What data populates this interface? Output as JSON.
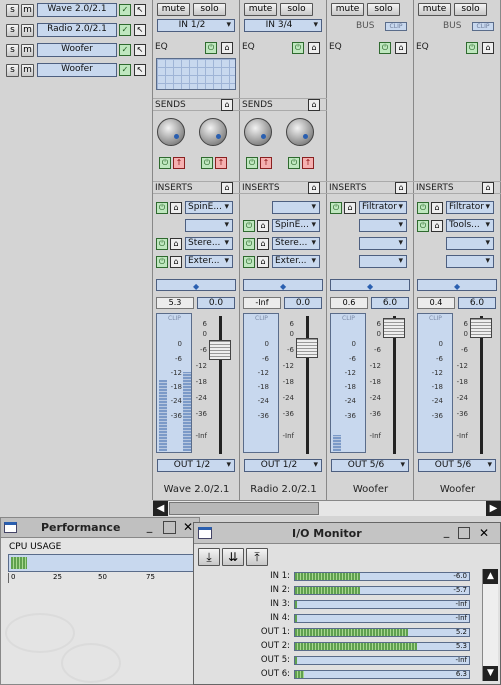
{
  "track_list": [
    {
      "label": "Wave 2.0/2.1"
    },
    {
      "label": "Radio 2.0/2.1"
    },
    {
      "label": "Woofer"
    },
    {
      "label": "Woofer"
    }
  ],
  "track_buttons": {
    "s": "s",
    "m": "m"
  },
  "channels": [
    {
      "mute": "mute",
      "solo": "solo",
      "input": "IN 1/2",
      "bus": null,
      "sends_label": "SENDS",
      "inserts": [
        "SpinE...",
        "",
        "Stere...",
        "Exter..."
      ],
      "pan_value": "5.3",
      "gain_value": "0.0",
      "output": "OUT 1/2",
      "name": "Wave 2.0/2.1"
    },
    {
      "mute": "mute",
      "solo": "solo",
      "input": "IN 3/4",
      "bus": null,
      "sends_label": "SENDS",
      "inserts": [
        "",
        "SpinE...",
        "Stere...",
        "Exter..."
      ],
      "pan_value": "-Inf",
      "gain_value": "0.0",
      "output": "OUT 1/2",
      "name": "Radio 2.0/2.1"
    },
    {
      "mute": "mute",
      "solo": "solo",
      "input": null,
      "bus": "BUS",
      "sends_label": "",
      "inserts": [
        "Filtrator",
        "",
        "",
        ""
      ],
      "pan_value": "0.6",
      "gain_value": "6.0",
      "output": "OUT 5/6",
      "name": "Woofer"
    },
    {
      "mute": "mute",
      "solo": "solo",
      "input": null,
      "bus": "BUS",
      "sends_label": "",
      "inserts": [
        "Filtrator",
        "Tools...",
        "",
        ""
      ],
      "pan_value": "0.4",
      "gain_value": "6.0",
      "output": "OUT 5/6",
      "name": "Woofer"
    }
  ],
  "section_labels": {
    "eq": "EQ",
    "inserts": "INSERTS",
    "clip": "CLIP"
  },
  "meter_scale": [
    "6",
    "0",
    "-6",
    "-12",
    "-18",
    "-24",
    "-36",
    "-Inf"
  ],
  "meter_scale_left": [
    "0",
    "-6",
    "-12",
    "-18",
    "-24",
    "-36"
  ],
  "performance": {
    "title": "Performance",
    "cpu_label": "CPU USAGE",
    "ticks": [
      "0",
      "25",
      "50",
      "75"
    ]
  },
  "io_monitor": {
    "title": "I/O Monitor",
    "rows": [
      {
        "label": "IN 1:",
        "value": "-6.0",
        "level": 0.15
      },
      {
        "label": "IN 2:",
        "value": "-5.7",
        "level": 0.15
      },
      {
        "label": "IN 3:",
        "value": "-Inf",
        "level": 0.0
      },
      {
        "label": "IN 4:",
        "value": "-Inf",
        "level": 0.0
      },
      {
        "label": "OUT 1:",
        "value": "5.2",
        "level": 0.26
      },
      {
        "label": "OUT 2:",
        "value": "5.3",
        "level": 0.28
      },
      {
        "label": "OUT 5:",
        "value": "-Inf",
        "level": 0.0
      },
      {
        "label": "OUT 6:",
        "value": "6.3",
        "level": 0.02
      }
    ]
  },
  "colors": {
    "lcd": "#c8d8ee",
    "power_on": "#bfe7bf",
    "power_red": "#f5b0b0",
    "panel": "#d4d4d4"
  }
}
